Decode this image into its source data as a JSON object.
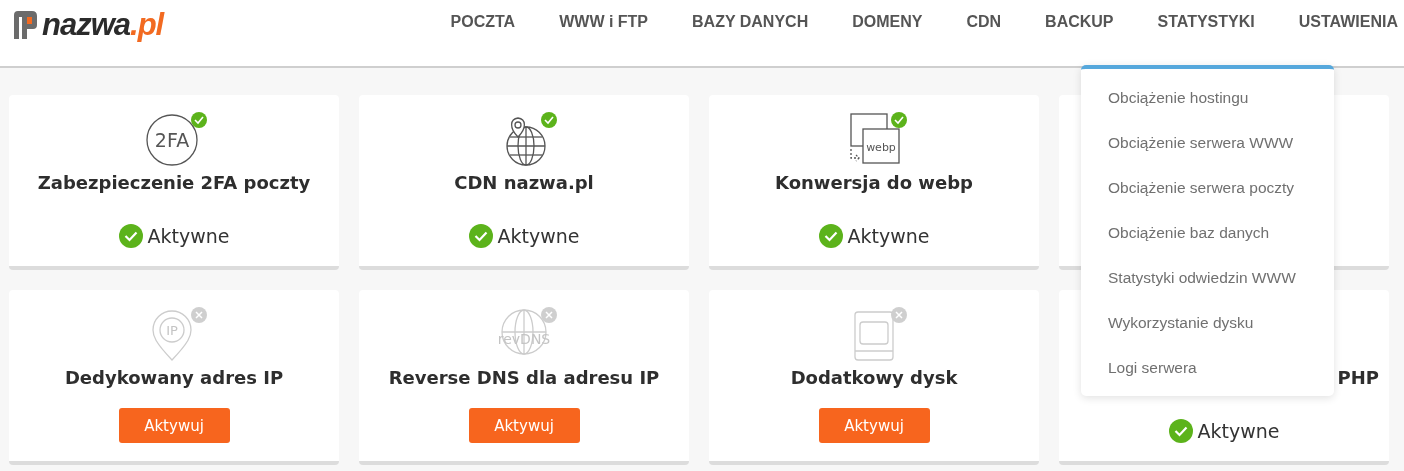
{
  "logo": {
    "name": "nazwa",
    "suffix": ".pl"
  },
  "nav": [
    "POCZTA",
    "WWW i FTP",
    "BAZY DANYCH",
    "DOMENY",
    "CDN",
    "BACKUP",
    "STATYSTYKI",
    "USTAWIENIA"
  ],
  "dropdown": [
    "Obciążenie hostingu",
    "Obciążenie serwera WWW",
    "Obciążenie serwera poczty",
    "Obciążenie baz danych",
    "Statystyki odwiedzin WWW",
    "Wykorzystanie dysku",
    "Logi serwera"
  ],
  "cards": [
    {
      "kind": "twofactor",
      "icon_label": "2FA",
      "title": "Zabezpieczenie 2FA poczty",
      "active": true,
      "status": "Aktywne"
    },
    {
      "kind": "globe",
      "title": "CDN nazwa.pl",
      "active": true,
      "status": "Aktywne"
    },
    {
      "kind": "webp",
      "icon_label": "webp",
      "title": "Konwersja do webp",
      "active": true,
      "status": "Aktywne"
    },
    {
      "kind": "covered"
    },
    {
      "kind": "ip",
      "icon_label": "IP",
      "title": "Dedykowany adres IP",
      "active": false,
      "button": "Aktywuj"
    },
    {
      "kind": "revdns",
      "icon_label": "revDNS",
      "title": "Reverse DNS dla adresu IP",
      "active": false,
      "button": "Aktywuj"
    },
    {
      "kind": "disk",
      "title": "Dodatkowy dysk",
      "active": false,
      "button": "Aktywuj"
    },
    {
      "kind": "covered",
      "title": "PHP",
      "status": "Aktywne"
    }
  ]
}
